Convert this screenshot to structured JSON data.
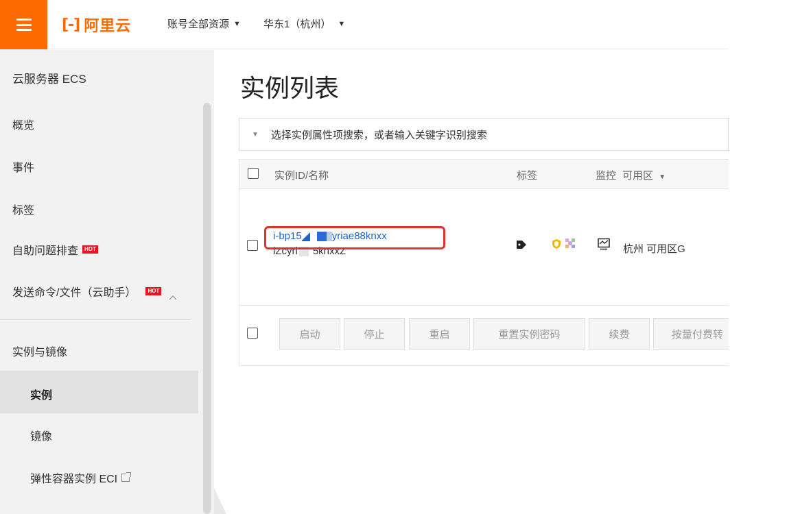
{
  "topbar": {
    "logo_mark": "[-]",
    "logo_text": "阿里云",
    "account_resources": "账号全部资源",
    "region": "华东1（杭州）",
    "brand_color": "#ff6a00"
  },
  "sidebar": {
    "title": "云服务器 ECS",
    "items": [
      {
        "label": "概览"
      },
      {
        "label": "事件"
      },
      {
        "label": "标签"
      },
      {
        "label": "自助问题排查",
        "badge": "HOT"
      },
      {
        "label": "发送命令/文件（云助手）",
        "badge": "HOT"
      }
    ],
    "group": {
      "label": "实例与镜像",
      "children": [
        {
          "label": "实例",
          "active": true
        },
        {
          "label": "镜像"
        },
        {
          "label": "弹性容器实例 ECI"
        }
      ]
    }
  },
  "main": {
    "title": "实例列表",
    "search_placeholder": "选择实例属性项搜索，或者输入关键字识别搜索",
    "columns": [
      "实例ID/名称",
      "标签",
      "监控",
      "可用区"
    ],
    "rows": [
      {
        "id_prefix": "i-bp15",
        "id_suffix": "yriae88knxx",
        "name_prefix": "iZcyri",
        "name_suffix": "5knxxZ",
        "zone": "杭州 可用区G"
      }
    ],
    "actions": [
      "启动",
      "停止",
      "重启",
      "重置实例密码",
      "续费",
      "按量付费转"
    ]
  },
  "icons": [
    "menu-icon",
    "tag-icon",
    "shield-icon",
    "cog-icon",
    "monitor-icon",
    "chevron-up-icon",
    "external-link-icon"
  ]
}
